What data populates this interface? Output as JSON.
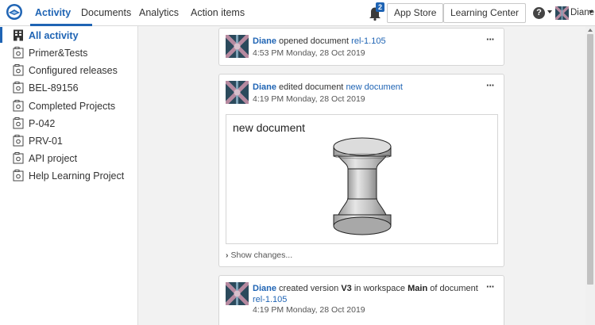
{
  "nav": {
    "tabs": [
      {
        "label": "Activity",
        "active": true
      },
      {
        "label": "Documents"
      },
      {
        "label": "Analytics"
      },
      {
        "label": "Action items"
      }
    ],
    "notification_count": "2",
    "app_store": "App Store",
    "learning_center": "Learning Center",
    "help_glyph": "?",
    "user_name": "Diane",
    "accent_color": "#1f64b4"
  },
  "sidebar": {
    "items": [
      {
        "label": "All activity",
        "icon": "building-icon",
        "active": true
      },
      {
        "label": "Primer&Tests",
        "icon": "folder-icon"
      },
      {
        "label": "Configured releases",
        "icon": "folder-icon"
      },
      {
        "label": "BEL-89156",
        "icon": "folder-icon"
      },
      {
        "label": "Completed Projects",
        "icon": "folder-icon"
      },
      {
        "label": "P-042",
        "icon": "folder-icon"
      },
      {
        "label": "PRV-01",
        "icon": "folder-icon"
      },
      {
        "label": "API project",
        "icon": "folder-icon"
      },
      {
        "label": "Help Learning Project",
        "icon": "folder-icon"
      }
    ]
  },
  "feed": [
    {
      "user": "Diane",
      "action": "opened document",
      "doc": "rel-1.105",
      "time": "4:53 PM Monday, 28 Oct 2019",
      "more": "···"
    },
    {
      "user": "Diane",
      "action": "edited document",
      "doc": "new document",
      "time": "4:19 PM Monday, 28 Oct 2019",
      "more": "···",
      "preview_title": "new document",
      "show_changes": "Show changes..."
    },
    {
      "user": "Diane",
      "action_pre": "created version",
      "version": "V3",
      "action_mid": "in workspace",
      "workspace": "Main",
      "action_post": "of document",
      "doc": "rel-1.105",
      "time": "4:19 PM Monday, 28 Oct 2019",
      "more": "···"
    }
  ]
}
